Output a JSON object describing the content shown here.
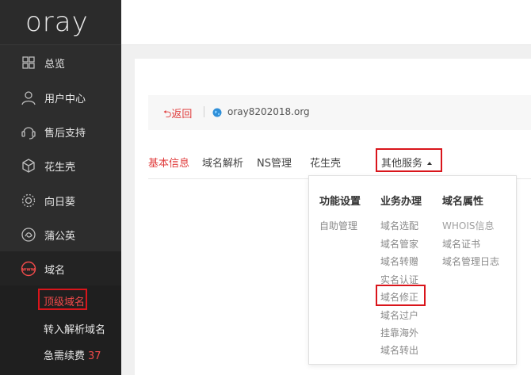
{
  "sidebar": {
    "logo": "oray",
    "items": [
      {
        "label": "总览",
        "icon": "dashboard-grid-icon"
      },
      {
        "label": "用户中心",
        "icon": "user-icon"
      },
      {
        "label": "售后支持",
        "icon": "headset-icon"
      },
      {
        "label": "花生壳",
        "icon": "peanut-shell-icon"
      },
      {
        "label": "向日葵",
        "icon": "sunflower-icon"
      },
      {
        "label": "蒲公英",
        "icon": "dandelion-icon"
      },
      {
        "label": "域名",
        "icon": "www-icon"
      }
    ],
    "sub_items": [
      {
        "label": "顶级域名",
        "selected": true
      },
      {
        "label": "转入解析域名"
      },
      {
        "label": "急需续费",
        "badge": "37"
      }
    ]
  },
  "breadcrumb": {
    "back": "返回",
    "domain": "oray8202018.org"
  },
  "tabs": [
    {
      "label": "基本信息",
      "active": true
    },
    {
      "label": "域名解析"
    },
    {
      "label": "NS管理"
    },
    {
      "label": "花生壳"
    },
    {
      "label": "其他服务"
    }
  ],
  "dropdown": {
    "columns": [
      {
        "title": "功能设置",
        "items": [
          "自助管理"
        ]
      },
      {
        "title": "业务办理",
        "items": [
          "域名选配",
          "域名管家",
          "域名转赠",
          "实名认证",
          "域名修正",
          "域名过户",
          "挂靠海外",
          "域名转出"
        ]
      },
      {
        "title": "域名属性",
        "items": [
          "WHOIS信息",
          "域名证书",
          "域名管理日志"
        ]
      }
    ]
  },
  "colors": {
    "accent": "#e03c3c",
    "highlight_box": "#d9151b",
    "sidebar_bg": "#2d2d2d"
  }
}
